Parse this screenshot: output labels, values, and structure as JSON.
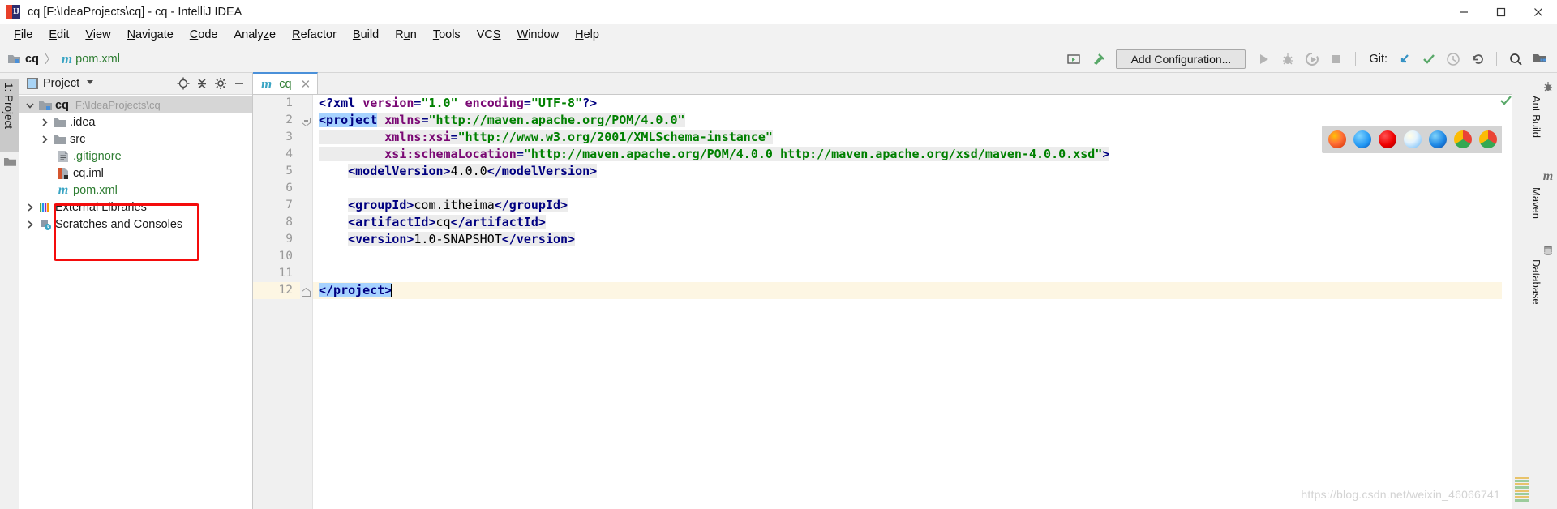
{
  "window": {
    "title": "cq [F:\\IdeaProjects\\cq] - cq - IntelliJ IDEA",
    "logo_name": "intellij-idea-logo",
    "minimize_label": "Minimize",
    "maximize_label": "Maximize",
    "close_label": "Close"
  },
  "menubar": {
    "items": [
      {
        "label": "File",
        "mnemonic": "F"
      },
      {
        "label": "Edit",
        "mnemonic": "E"
      },
      {
        "label": "View",
        "mnemonic": "V"
      },
      {
        "label": "Navigate",
        "mnemonic": "N"
      },
      {
        "label": "Code",
        "mnemonic": "C"
      },
      {
        "label": "Analyze",
        "mnemonic": "z"
      },
      {
        "label": "Refactor",
        "mnemonic": "R"
      },
      {
        "label": "Build",
        "mnemonic": "B"
      },
      {
        "label": "Run",
        "mnemonic": "u"
      },
      {
        "label": "Tools",
        "mnemonic": "T"
      },
      {
        "label": "VCS",
        "mnemonic": "S"
      },
      {
        "label": "Window",
        "mnemonic": "W"
      },
      {
        "label": "Help",
        "mnemonic": "H"
      }
    ]
  },
  "toolbar": {
    "breadcrumb_project": "cq",
    "breadcrumb_separator": "〉",
    "breadcrumb_file": "pom.xml",
    "breadcrumb_file_icon": "maven-m-icon",
    "config_button": "Add Configuration...",
    "git_label": "Git:",
    "icons": [
      {
        "name": "make-project-icon"
      },
      {
        "name": "build-hammer-icon"
      },
      {
        "name": "run-icon"
      },
      {
        "name": "debug-icon"
      },
      {
        "name": "run-with-coverage-icon"
      },
      {
        "name": "stop-icon"
      },
      {
        "name": "git-update-icon"
      },
      {
        "name": "git-commit-icon"
      },
      {
        "name": "git-history-icon"
      },
      {
        "name": "git-rollback-icon"
      },
      {
        "name": "search-everywhere-icon"
      },
      {
        "name": "project-structure-icon"
      }
    ]
  },
  "left_toolwindow": {
    "tab_label": "1: Project",
    "favorites_icon": "folder-icon"
  },
  "project_panel": {
    "header_title": "Project",
    "header_icon": "project-view-icon",
    "header_dropdown_icon": "chevron-down-icon",
    "header_buttons": [
      {
        "name": "locate-icon"
      },
      {
        "name": "collapse-all-icon"
      },
      {
        "name": "settings-gear-icon"
      },
      {
        "name": "hide-icon"
      }
    ],
    "tree": [
      {
        "label": "cq",
        "sublabel": "F:\\IdeaProjects\\cq",
        "icon": "project-folder-icon",
        "arrow": "expanded",
        "depth": 0,
        "selected": true,
        "bold": true
      },
      {
        "label": ".idea",
        "sublabel": "",
        "icon": "folder-icon",
        "arrow": "collapsed",
        "depth": 1,
        "selected": false,
        "bold": false
      },
      {
        "label": "src",
        "sublabel": "",
        "icon": "folder-icon",
        "arrow": "collapsed",
        "depth": 1,
        "selected": false,
        "bold": false
      },
      {
        "label": ".gitignore",
        "sublabel": "",
        "icon": "gitignore-file-icon",
        "arrow": "none",
        "depth": 1,
        "selected": false,
        "bold": false,
        "green": true
      },
      {
        "label": "cq.iml",
        "sublabel": "",
        "icon": "iml-file-icon",
        "arrow": "none",
        "depth": 1,
        "selected": false,
        "bold": false
      },
      {
        "label": "pom.xml",
        "sublabel": "",
        "icon": "maven-m-icon",
        "arrow": "none",
        "depth": 1,
        "selected": false,
        "bold": false,
        "green": true
      },
      {
        "label": "External Libraries",
        "sublabel": "",
        "icon": "libraries-icon",
        "arrow": "collapsed",
        "depth": 0,
        "selected": false,
        "bold": false
      },
      {
        "label": "Scratches and Consoles",
        "sublabel": "",
        "icon": "scratches-icon",
        "arrow": "collapsed",
        "depth": 0,
        "selected": false,
        "bold": false
      }
    ],
    "annotation": {
      "name": "red-highlight-box",
      "color": "#f40c0c"
    }
  },
  "editor": {
    "tab": {
      "label": "cq",
      "icon": "maven-m-icon",
      "close_icon": "close-icon"
    },
    "line_numbers": [
      1,
      2,
      3,
      4,
      5,
      6,
      7,
      8,
      9,
      10,
      11,
      12
    ],
    "lines": [
      "<?xml version=\"1.0\" encoding=\"UTF-8\"?>",
      "<project xmlns=\"http://maven.apache.org/POM/4.0.0\"",
      "         xmlns:xsi=\"http://www.w3.org/2001/XMLSchema-instance\"",
      "         xsi:schemaLocation=\"http://maven.apache.org/POM/4.0.0 http://maven.apache.org/xsd/maven-4.0.0.xsd\">",
      "    <modelVersion>4.0.0</modelVersion>",
      "",
      "    <groupId>com.itheima</groupId>",
      "    <artifactId>cq</artifactId>",
      "    <version>1.0-SNAPSHOT</version>",
      "",
      "",
      "</project>"
    ],
    "caret_line": 12,
    "inspection_status_icon": "inspections-ok-check",
    "browser_popup": {
      "name": "open-in-browser-popup",
      "browsers": [
        "firefox",
        "safari",
        "opera",
        "internet-explorer",
        "edge",
        "chrome",
        "chrome-canary"
      ]
    }
  },
  "right_toolwindow": {
    "items": [
      {
        "label": "Ant Build",
        "icon": "ant-bug-icon"
      },
      {
        "label": "Maven",
        "icon": "maven-m-icon"
      },
      {
        "label": "Database",
        "icon": "database-icon"
      }
    ]
  },
  "watermark": {
    "text": "https://blog.csdn.net/weixin_46066741"
  },
  "colors": {
    "accent_blue": "#4a90d9",
    "annotation_red": "#f40c0c",
    "xml_tag": "#000080",
    "xml_attr": "#7a0874",
    "xml_value": "#008000",
    "selection": "#a6d2ff",
    "caret_line": "#fdf6e3"
  }
}
